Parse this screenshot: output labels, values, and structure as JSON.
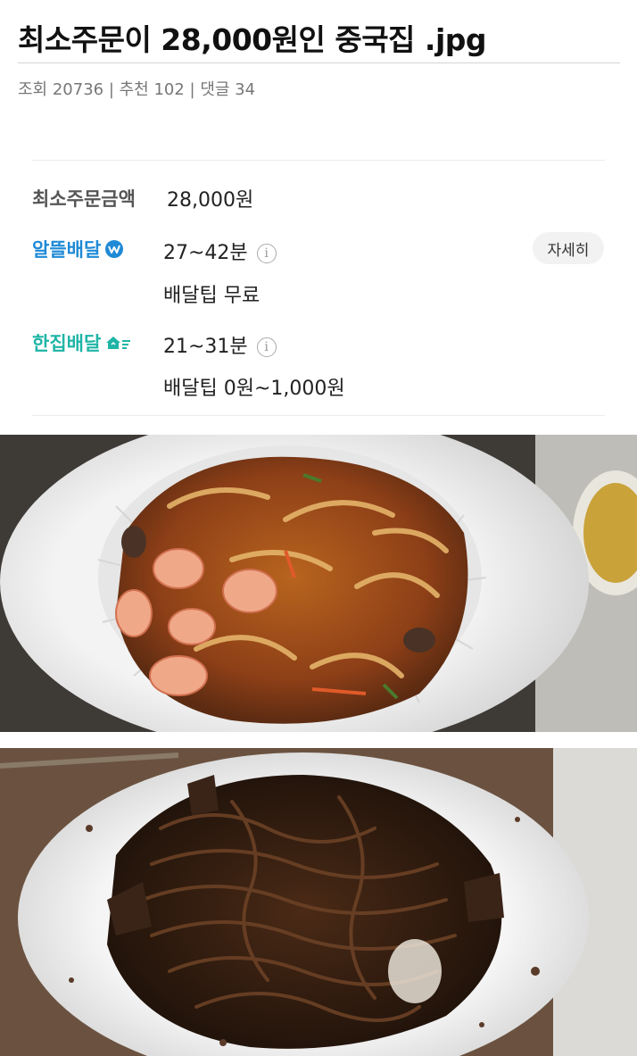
{
  "post": {
    "title": "최소주문이 28,000원인 중국집 .jpg",
    "meta": "조회 20736 | 추천 102 | 댓글 34"
  },
  "store_info": {
    "min_order_label": "최소주문금액",
    "min_order_value": "28,000원",
    "detail_button": "자세히",
    "albbeul": {
      "label": "알뜰배달",
      "label_color": "#1f8ad6",
      "time": "27~42분",
      "tip": "배달팁 무료"
    },
    "hanjip": {
      "label": "한집배달",
      "label_color": "#1fb5a6",
      "time": "21~31분",
      "tip": "배달팁 0원~1,000원"
    },
    "info_icon": "i"
  },
  "photos": [
    {
      "name": "seafood-stir-fry-photo",
      "icon": "photo-seafood-noodle"
    },
    {
      "name": "jajangmyeon-photo",
      "icon": "photo-jajangmyeon"
    }
  ]
}
